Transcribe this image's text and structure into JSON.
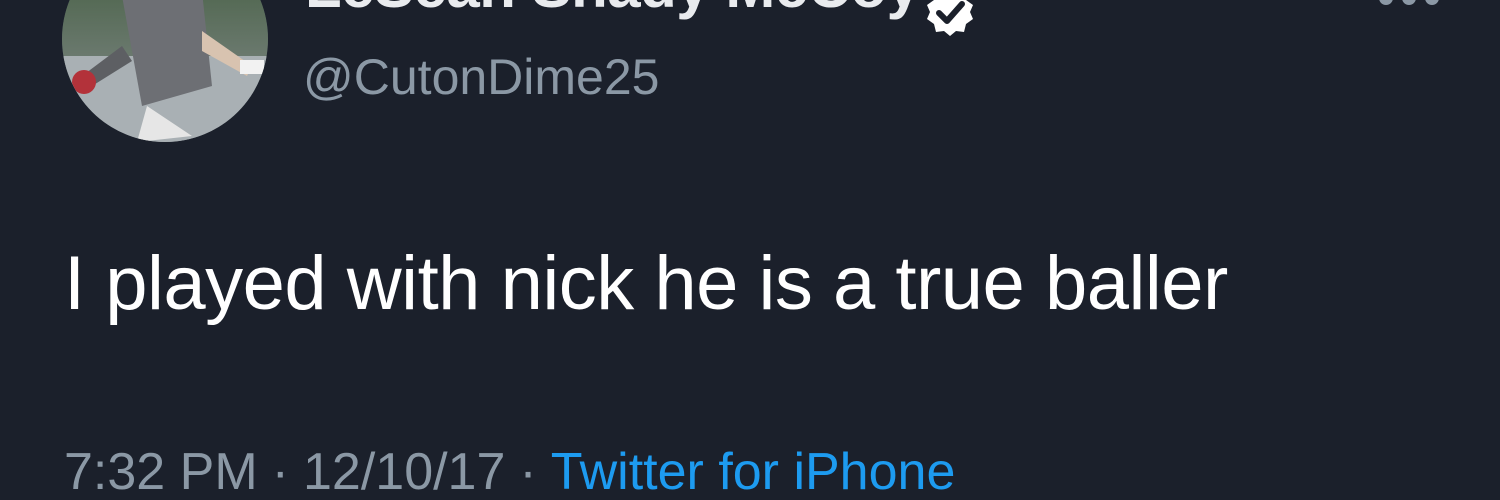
{
  "author": {
    "display_name": "LeSean Shady McCoy",
    "handle": "@CutonDime25",
    "verified": true,
    "avatar_icon": "profile-photo-icon"
  },
  "tweet": {
    "text": "I played with nick he is a true baller"
  },
  "meta": {
    "time": "7:32 PM",
    "separator": "·",
    "date": "12/10/17",
    "source": "Twitter for iPhone"
  },
  "icons": {
    "verified": "verified-badge-icon",
    "more": "more-options-icon"
  },
  "colors": {
    "background": "#1b202b",
    "text_primary": "#ffffff",
    "text_secondary": "#8b98a5",
    "link": "#1d9bf0"
  }
}
